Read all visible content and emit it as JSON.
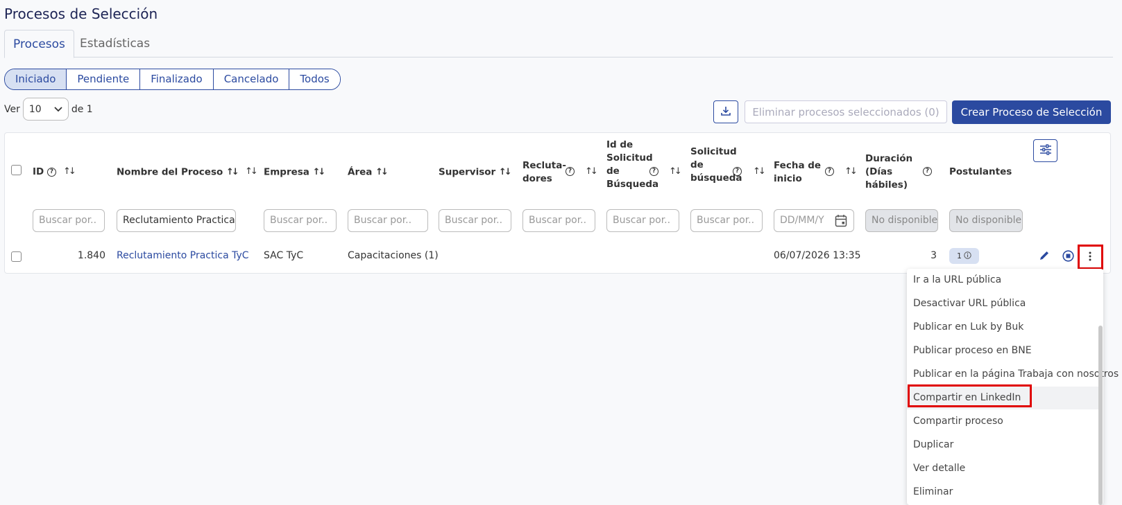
{
  "page": {
    "title": "Procesos de Selección"
  },
  "tabs": [
    {
      "label": "Procesos",
      "active": true
    },
    {
      "label": "Estadísticas",
      "active": false
    }
  ],
  "status_filters": [
    {
      "label": "Iniciado",
      "active": true
    },
    {
      "label": "Pendiente",
      "active": false
    },
    {
      "label": "Finalizado",
      "active": false
    },
    {
      "label": "Cancelado",
      "active": false
    },
    {
      "label": "Todos",
      "active": false
    }
  ],
  "pagination": {
    "ver_label": "Ver",
    "page_size": "10",
    "of_label": "de 1"
  },
  "toolbar": {
    "download_icon": "download-icon",
    "delete_label": "Eliminar procesos seleccionados (0)",
    "create_label": "Crear Proceso de Selección"
  },
  "table": {
    "columns": [
      {
        "key": "id",
        "label": "ID"
      },
      {
        "key": "nombre",
        "label": "Nombre del Proceso"
      },
      {
        "key": "empresa",
        "label": "Empresa"
      },
      {
        "key": "area",
        "label": "Área"
      },
      {
        "key": "supervisor",
        "label": "Supervisor"
      },
      {
        "key": "reclutadores",
        "label": "Recluta-dores"
      },
      {
        "key": "id_solicitud",
        "label": "Id de Solicitud de Búsqueda"
      },
      {
        "key": "solicitud",
        "label": "Solicitud de búsqueda"
      },
      {
        "key": "fecha_inicio",
        "label": "Fecha de inicio"
      },
      {
        "key": "duracion",
        "label": "Duración (Días hábiles)"
      },
      {
        "key": "postulantes",
        "label": "Postulantes"
      }
    ],
    "filters": {
      "id": {
        "value": "",
        "placeholder": "Buscar por.."
      },
      "nombre": {
        "value": "Reclutamiento Practica",
        "placeholder": "Buscar por.."
      },
      "empresa": {
        "value": "",
        "placeholder": "Buscar por.."
      },
      "area": {
        "value": "",
        "placeholder": "Buscar por.."
      },
      "supervisor": {
        "value": "",
        "placeholder": "Buscar por.."
      },
      "reclutadores": {
        "value": "",
        "placeholder": "Buscar por.."
      },
      "id_solicitud": {
        "value": "",
        "placeholder": "Buscar por.."
      },
      "solicitud": {
        "value": "",
        "placeholder": "Buscar por.."
      },
      "fecha_inicio": {
        "value": "",
        "placeholder": "DD/MM/Y"
      },
      "duracion": {
        "value": "No disponible"
      },
      "postulantes": {
        "value": "No disponible"
      }
    },
    "rows": [
      {
        "id": "1.840",
        "nombre": "Reclutamiento Practica TyC",
        "empresa": "SAC TyC",
        "area": "Capacitaciones (1)",
        "supervisor": "",
        "reclutadores": "",
        "id_solicitud": "",
        "solicitud": "",
        "fecha_inicio": "06/07/2026 13:35",
        "duracion": "3",
        "postulantes": "1"
      }
    ]
  },
  "row_menu": {
    "items": [
      "Ir a la URL pública",
      "Desactivar URL pública",
      "Publicar en Luk by Buk",
      "Publicar proceso en BNE",
      "Publicar en la página Trabaja con nosotros",
      "Compartir en LinkedIn",
      "Compartir proceso",
      "Duplicar",
      "Ver detalle",
      "Eliminar"
    ],
    "highlighted_index": 5
  },
  "colors": {
    "primary": "#2b4aa0",
    "highlight": "#e00000",
    "badge_bg": "#d7e0f2"
  }
}
